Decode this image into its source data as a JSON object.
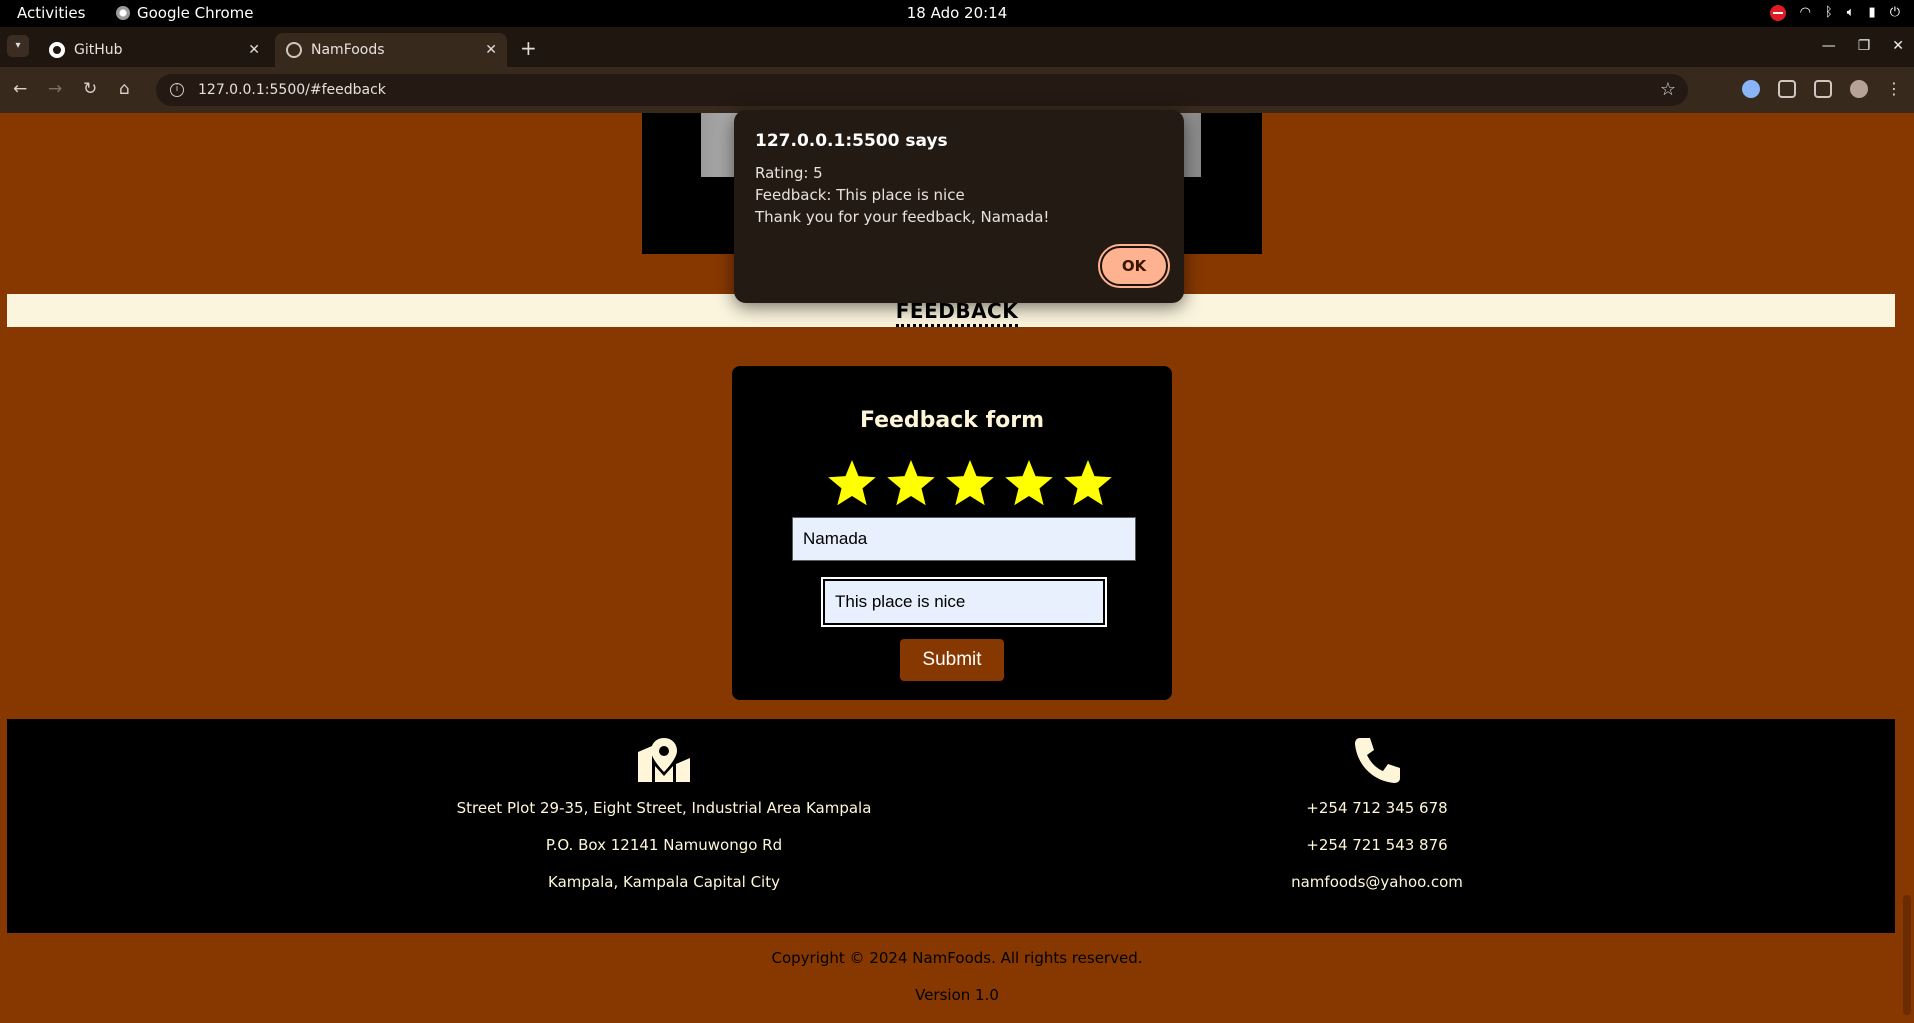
{
  "system_bar": {
    "activities": "Activities",
    "app_name": "Google Chrome",
    "clock": "18 Ado  20:14"
  },
  "browser": {
    "tabs": [
      {
        "label": "GitHub",
        "active": false
      },
      {
        "label": "NamFoods",
        "active": true
      }
    ],
    "url": "127.0.0.1:5500/#feedback"
  },
  "page": {
    "section_title": "FEEDBACK",
    "form": {
      "title": "Feedback form",
      "rating": 5,
      "star_color": "#ffff00",
      "name_value": "Namada",
      "feedback_value": "This place is nice",
      "submit_label": "Submit"
    },
    "footer": {
      "address": [
        "Street Plot 29-35, Eight Street, Industrial Area Kampala",
        "P.O. Box 12141 Namuwongo Rd",
        "Kampala, Kampala Capital City"
      ],
      "contacts": [
        "+254 712 345 678",
        "+254 721 543 876",
        "namfoods@yahoo.com"
      ]
    },
    "copyright": "Copyright © 2024 NamFoods. All rights reserved.",
    "version": "Version 1.0",
    "colors": {
      "page_bg": "#873800",
      "band_bg": "#fbf5de",
      "text_cream": "#fff6d9"
    }
  },
  "alert": {
    "title": "127.0.0.1:5500 says",
    "lines": [
      "Rating: 5",
      "Feedback: This place is nice",
      "Thank you for your feedback, Namada!"
    ],
    "ok_label": "OK"
  }
}
